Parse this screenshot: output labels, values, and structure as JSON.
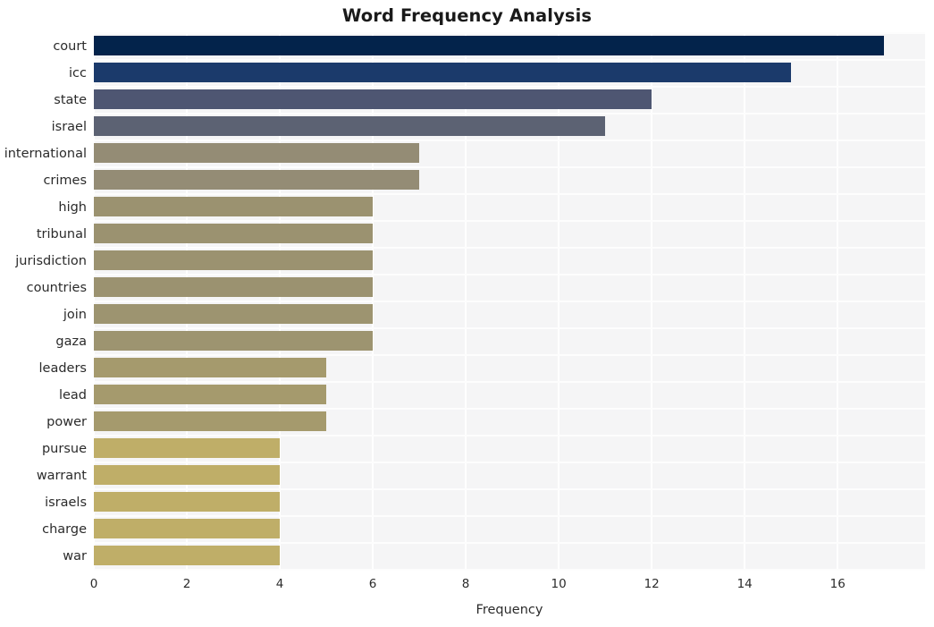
{
  "chart_data": {
    "type": "bar",
    "orientation": "horizontal",
    "title": "Word Frequency Analysis",
    "xlabel": "Frequency",
    "ylabel": "",
    "categories": [
      "court",
      "icc",
      "state",
      "israel",
      "international",
      "crimes",
      "high",
      "tribunal",
      "jurisdiction",
      "countries",
      "join",
      "gaza",
      "leaders",
      "lead",
      "power",
      "pursue",
      "warrant",
      "israels",
      "charge",
      "war"
    ],
    "values": [
      17,
      15,
      12,
      11,
      7,
      7,
      6,
      6,
      6,
      6,
      6,
      6,
      5,
      5,
      5,
      4,
      4,
      4,
      4,
      4
    ],
    "bar_colors": [
      "#03234b",
      "#1b3a6b",
      "#4e5672",
      "#5c6273",
      "#948c75",
      "#948c75",
      "#9b9270",
      "#9b9270",
      "#9b9270",
      "#9b9270",
      "#9d9470",
      "#9d9470",
      "#a59a6d",
      "#a59a6d",
      "#a59a6d",
      "#bfae68",
      "#bfae68",
      "#bfae68",
      "#bfae68",
      "#bfae68"
    ],
    "xlim": [
      0,
      17.88
    ],
    "xticks": [
      0,
      2,
      4,
      6,
      8,
      10,
      12,
      14,
      16
    ],
    "xtick_labels": [
      "0",
      "2",
      "4",
      "6",
      "8",
      "10",
      "12",
      "14",
      "16"
    ],
    "grid": true,
    "grid_color": "#ffffff",
    "plot_background": "#f5f5f6",
    "figure_background": "#ffffff",
    "legend": null,
    "legend_position": "none"
  }
}
